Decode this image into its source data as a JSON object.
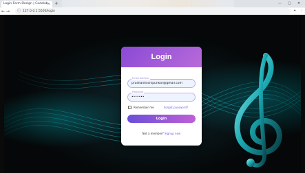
{
  "browser": {
    "tab_title": "Login Form Design | Codelab",
    "tab_close": "×",
    "new_tab": "+",
    "address": "127.0.0.1:5500/login",
    "back": "←",
    "forward": "→",
    "reload": "C",
    "info": "ⓘ",
    "minimize": "—",
    "maximize": "▢",
    "close": "✕",
    "ext": "✦",
    "menu": "⋮"
  },
  "login": {
    "title": "Login",
    "email": {
      "label": "Email Address",
      "value": "prashantsichipunkar@gmail.com"
    },
    "password": {
      "label": "Password",
      "value": "•••••••"
    },
    "remember_label": "Remember me",
    "forgot_label": "Forgot password?",
    "submit_label": "Login",
    "not_member": "Not a member?",
    "signup_label": "Signup now"
  },
  "icons": {
    "clef": "treble-clef-icon"
  },
  "colors": {
    "header_gradient_start": "#8a4ad6",
    "header_gradient_end": "#b86ad9",
    "accent": "#6c5ce7",
    "background": "#050708",
    "glow": "#00b4be"
  }
}
